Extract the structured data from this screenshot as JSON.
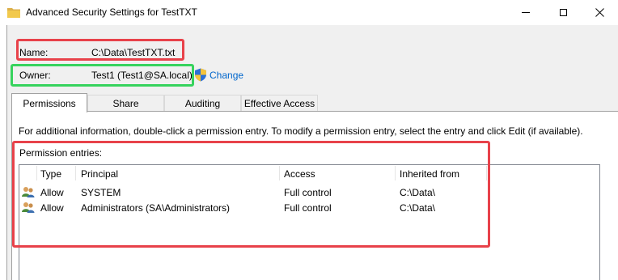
{
  "window": {
    "title": "Advanced Security Settings for TestTXT",
    "controls": {
      "minimize": "minimize-icon",
      "maximize": "maximize-icon",
      "close": "close-icon"
    }
  },
  "name": {
    "label": "Name:",
    "value": "C:\\Data\\TestTXT.txt"
  },
  "owner": {
    "label": "Owner:",
    "value": "Test1 (Test1@SA.local)",
    "change_label": "Change"
  },
  "tabs": [
    {
      "label": "Permissions",
      "active": true
    },
    {
      "label": "Share",
      "active": false
    },
    {
      "label": "Auditing",
      "active": false
    },
    {
      "label": "Effective Access",
      "active": false
    }
  ],
  "info_text": "For additional information, double-click a permission entry. To modify a permission entry, select the entry and click Edit (if available).",
  "permission_entries": {
    "label": "Permission entries:",
    "columns": [
      "Type",
      "Principal",
      "Access",
      "Inherited from"
    ],
    "rows": [
      {
        "icon": "users-icon",
        "type": "Allow",
        "principal": "SYSTEM",
        "access": "Full control",
        "inherited_from": "C:\\Data\\"
      },
      {
        "icon": "users-icon",
        "type": "Allow",
        "principal": "Administrators (SA\\Administrators)",
        "access": "Full control",
        "inherited_from": "C:\\Data\\"
      }
    ]
  },
  "colors": {
    "highlight_red": "#e8424a",
    "highlight_green": "#36d35d",
    "link": "#0066cc",
    "folder_yellow": "#f2c94c"
  }
}
